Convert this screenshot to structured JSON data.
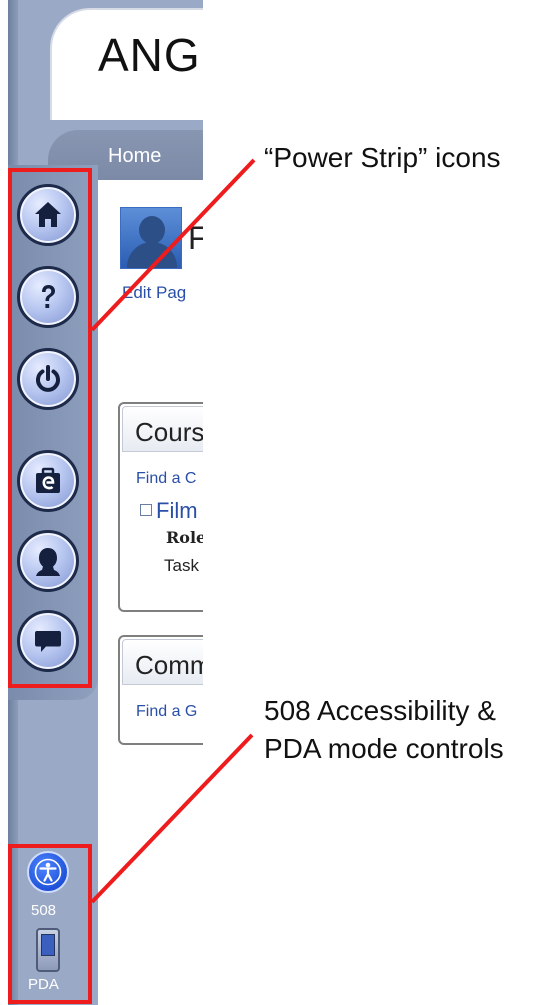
{
  "app": {
    "logo_text": "ANG",
    "nav": {
      "home_label": "Home"
    },
    "profile": {
      "name_fragment": "F",
      "edit_link": "Edit Pag"
    },
    "courses": {
      "title": "Cours",
      "find_link": "Find a C",
      "item_label": "Film",
      "role_label": "Role",
      "task_label": "Task"
    },
    "communities": {
      "title": "Comm",
      "find_link": "Find a G"
    },
    "power_strip": [
      {
        "icon": "home-icon",
        "symbol": "house"
      },
      {
        "icon": "help-icon",
        "symbol": "?"
      },
      {
        "icon": "power-icon",
        "symbol": "power"
      },
      {
        "icon": "eportfolio-icon",
        "symbol": "e"
      },
      {
        "icon": "profile-icon",
        "symbol": "person"
      },
      {
        "icon": "chat-icon",
        "symbol": "speech-bubble"
      }
    ],
    "accessibility": {
      "label_508": "508",
      "label_pda": "PDA"
    }
  },
  "annotations": {
    "power_strip_caption": "“Power Strip” icons",
    "accessibility_caption_line1": "508 Accessibility &",
    "accessibility_caption_line2": "PDA mode controls"
  },
  "colors": {
    "callout_red": "#ee1c1c",
    "strip_blue": "#8695b1",
    "link_blue": "#2a4fa8"
  }
}
